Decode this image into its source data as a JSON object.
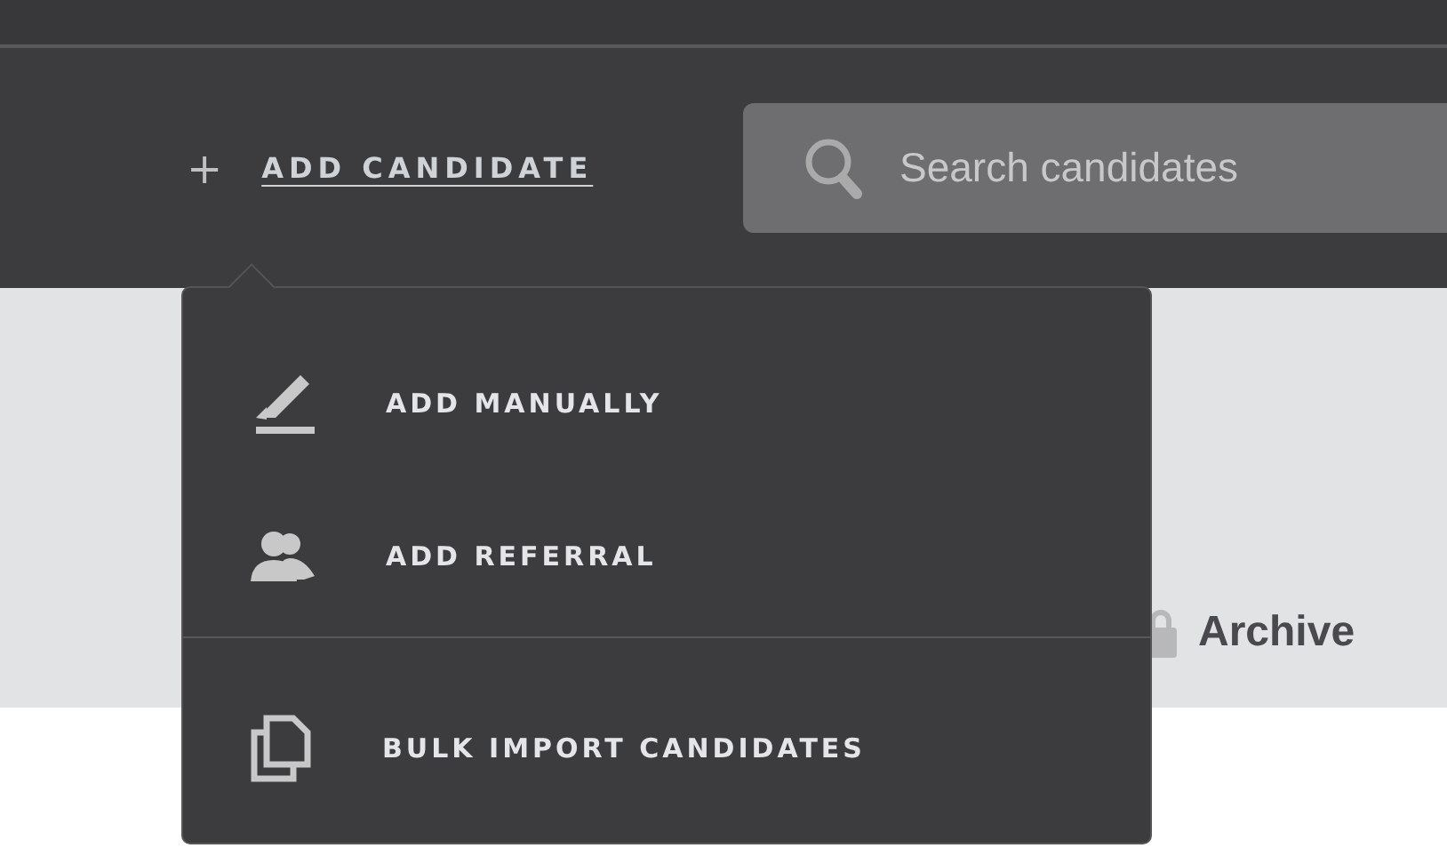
{
  "header": {
    "add_candidate": {
      "icon": "+",
      "label": "ADD CANDIDATE"
    },
    "search": {
      "placeholder": "Search candidates"
    }
  },
  "content": {
    "archive": {
      "label": "Archive"
    }
  },
  "menu": {
    "items": [
      {
        "kind": "manual",
        "label": "ADD MANUALLY",
        "divider_before": false
      },
      {
        "kind": "referral",
        "label": "ADD REFERRAL",
        "divider_before": false
      },
      {
        "kind": "bulk",
        "label": "BULK IMPORT CANDIDATES",
        "divider_before": true
      }
    ]
  }
}
